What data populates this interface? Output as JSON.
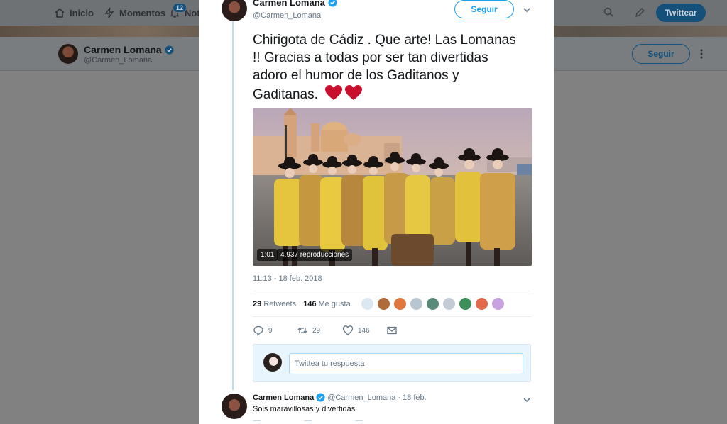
{
  "topnav": {
    "home_label": "Inicio",
    "moments_label": "Momentos",
    "notifications_label": "Noti",
    "notifications_count": "12",
    "tweet_button": "Twittear"
  },
  "profile_bar": {
    "name": "Carmen Lomana",
    "handle": "@Carmen_Lomana",
    "follow_button": "Seguir"
  },
  "tweet": {
    "author_name": "Carmen Lomana",
    "author_handle": "@Carmen_Lomana",
    "follow_button": "Seguir",
    "text": "Chirigota de Cádiz . Que arte! Las Lomanas !! Gracias a todas por ser tan divertidas adoro el humor de los Gaditanos y Gaditanas.",
    "video_duration": "1:01",
    "video_views": "4.937 reproducciones",
    "timestamp": "11:13 - 18 feb. 2018",
    "retweets_count": "29",
    "retweets_label": "Retweets",
    "likes_count": "146",
    "likes_label": "Me gusta",
    "actions": {
      "reply_count": "9",
      "retweet_count": "29",
      "like_count": "146"
    },
    "colors": {
      "accent": "#1da1f2",
      "heart": "#e0245e"
    }
  },
  "reply_box": {
    "placeholder": "Twittea tu respuesta"
  },
  "reply": {
    "author_name": "Carmen Lomana",
    "author_handle": "@Carmen_Lomana",
    "separator": "·",
    "date": "18 feb.",
    "text": "Sois maravillosas y divertidas"
  }
}
